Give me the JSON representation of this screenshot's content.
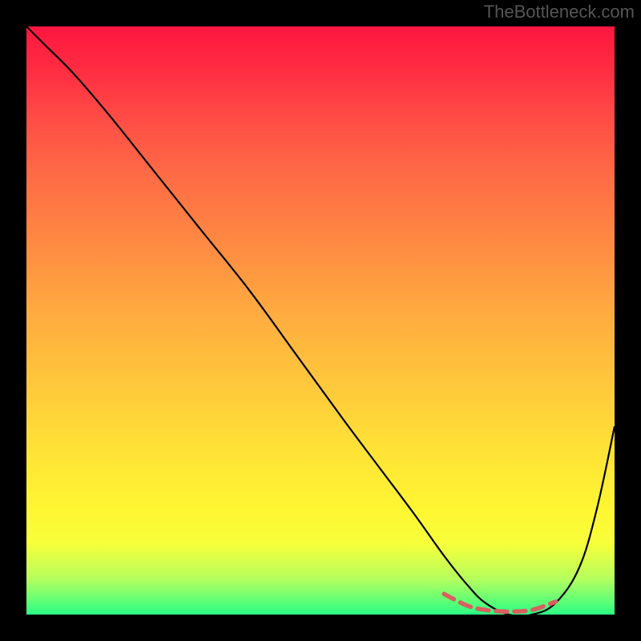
{
  "watermark": "TheBottleneck.com",
  "chart_data": {
    "type": "line",
    "title": "",
    "xlabel": "",
    "ylabel": "",
    "xlim": [
      0,
      100
    ],
    "ylim": [
      0,
      100
    ],
    "series": [
      {
        "name": "bottleneck-curve",
        "x": [
          0,
          3,
          8,
          14,
          22,
          30,
          38,
          46,
          54,
          60,
          66,
          71,
          75,
          78,
          82,
          86,
          90,
          94,
          97,
          100
        ],
        "y": [
          100,
          97,
          92,
          85,
          75,
          65,
          55,
          44,
          33,
          25,
          17,
          10,
          5,
          2,
          0,
          0,
          2,
          8,
          18,
          32
        ]
      },
      {
        "name": "optimal-range",
        "x": [
          71,
          75,
          78,
          82,
          86,
          90
        ],
        "y": [
          3.5,
          1.5,
          0.8,
          0.5,
          0.8,
          2.2
        ]
      }
    ],
    "gradient_stops": [
      {
        "pos": 0,
        "color": "#ff163f"
      },
      {
        "pos": 50,
        "color": "#ffb940"
      },
      {
        "pos": 85,
        "color": "#fff632"
      },
      {
        "pos": 100,
        "color": "#2aff85"
      }
    ]
  }
}
